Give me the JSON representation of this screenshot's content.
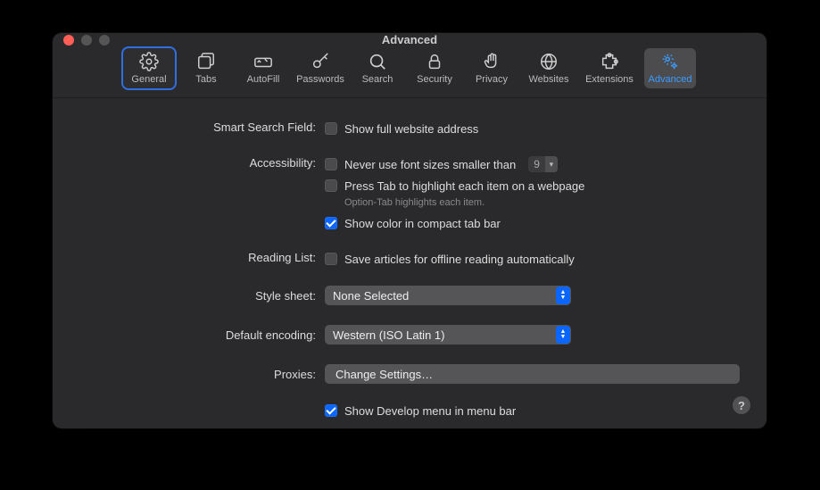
{
  "window": {
    "title": "Advanced"
  },
  "tabs": {
    "general": "General",
    "tabs": "Tabs",
    "autofill": "AutoFill",
    "passwords": "Passwords",
    "search": "Search",
    "security": "Security",
    "privacy": "Privacy",
    "websites": "Websites",
    "extensions": "Extensions",
    "advanced": "Advanced"
  },
  "sections": {
    "smartSearch": {
      "label": "Smart Search Field:",
      "showFullAddress": {
        "text": "Show full website address",
        "checked": false
      }
    },
    "accessibility": {
      "label": "Accessibility:",
      "minFont": {
        "text": "Never use font sizes smaller than",
        "checked": false,
        "value": "9"
      },
      "pressTab": {
        "text": "Press Tab to highlight each item on a webpage",
        "checked": false
      },
      "pressTabHint": "Option-Tab highlights each item.",
      "compactColor": {
        "text": "Show color in compact tab bar",
        "checked": true
      }
    },
    "readingList": {
      "label": "Reading List:",
      "saveOffline": {
        "text": "Save articles for offline reading automatically",
        "checked": false
      }
    },
    "styleSheet": {
      "label": "Style sheet:",
      "value": "None Selected"
    },
    "defaultEncoding": {
      "label": "Default encoding:",
      "value": "Western (ISO Latin 1)"
    },
    "proxies": {
      "label": "Proxies:",
      "button": "Change Settings…"
    },
    "develop": {
      "text": "Show Develop menu in menu bar",
      "checked": true
    }
  },
  "help": "?"
}
